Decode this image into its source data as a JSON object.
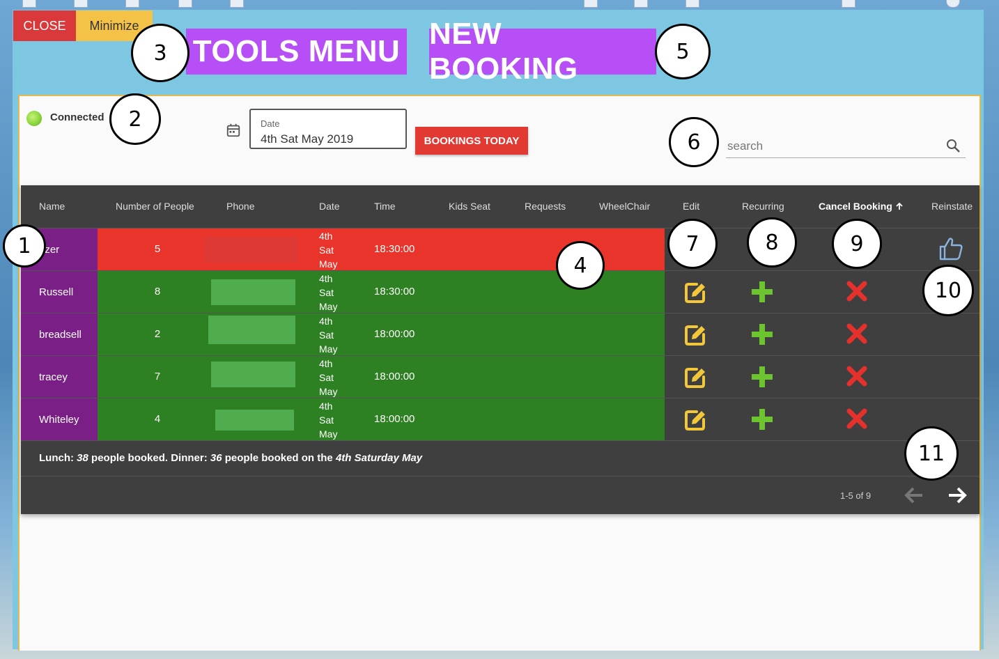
{
  "window": {
    "close_label": "CLOSE",
    "minimize_label": "Minimize"
  },
  "toolbar": {
    "tools_menu_label": "TOOLS MENU",
    "new_booking_label": "NEW BOOKING"
  },
  "status": {
    "connected_label": "Connected",
    "connected_color": "#8cd63b"
  },
  "date_picker": {
    "label": "Date",
    "value": "4th Sat May 2019",
    "icon": "calendar-icon"
  },
  "bookings_today_label": "BOOKINGS TODAY",
  "search": {
    "placeholder": "search",
    "icon": "search-icon"
  },
  "table": {
    "headers": [
      "Name",
      "Number of People",
      "Phone",
      "Date",
      "Time",
      "Kids Seat",
      "Requests",
      "WheelChair",
      "Edit",
      "Recurring",
      "Cancel Booking",
      "Reinstate"
    ],
    "sorted_column": "Cancel Booking",
    "sort_icon": "arrow-up-icon",
    "rows": [
      {
        "name": "uzer",
        "people": "5",
        "date_line1": "4th",
        "date_line2": "Sat",
        "date_line3": "May",
        "time": "18:30:00",
        "status": "cancelled",
        "row_color": "#e8342a"
      },
      {
        "name": "Russell",
        "people": "8",
        "date_line1": "4th",
        "date_line2": "Sat",
        "date_line3": "May",
        "time": "18:30:00",
        "status": "active",
        "row_color": "#2e8122"
      },
      {
        "name": "breadsell",
        "people": "2",
        "date_line1": "4th",
        "date_line2": "Sat",
        "date_line3": "May",
        "time": "18:00:00",
        "status": "active",
        "row_color": "#2e8122"
      },
      {
        "name": "tracey",
        "people": "7",
        "date_line1": "4th",
        "date_line2": "Sat",
        "date_line3": "May",
        "time": "18:00:00",
        "status": "active",
        "row_color": "#2e8122"
      },
      {
        "name": "Whiteley",
        "people": "4",
        "date_line1": "4th",
        "date_line2": "Sat",
        "date_line3": "May",
        "time": "18:00:00",
        "status": "active",
        "row_color": "#2e8122"
      }
    ],
    "summary": {
      "lunch_label": "Lunch:",
      "lunch_count": "38",
      "people_booked_1": "people booked. Dinner:",
      "dinner_count": "36",
      "people_booked_2": "people booked on the",
      "day": "4th Saturday May"
    },
    "pagination": {
      "range_text": "1-5 of 9"
    }
  },
  "annotations": [
    "1",
    "2",
    "3",
    "4",
    "5",
    "6",
    "7",
    "8",
    "9",
    "10",
    "11"
  ],
  "colors": {
    "accent_purple": "#b64ff5",
    "name_column": "#7a1f86",
    "cancelled_row": "#e8342a",
    "active_row": "#2e8122",
    "edit_icon": "#f3c73a",
    "recurring_icon": "#6cc42f",
    "cancel_icon": "#e5312c"
  }
}
